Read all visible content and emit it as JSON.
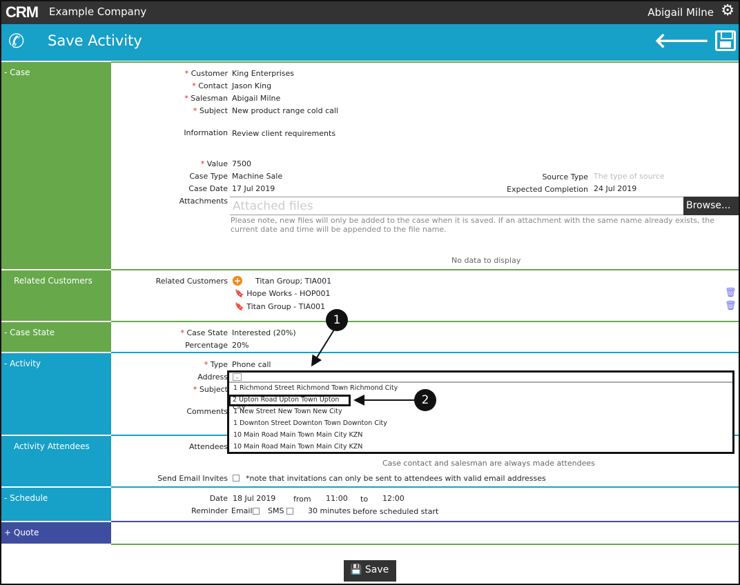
{
  "topbar": {
    "logo": "CRM",
    "company": "Example Company",
    "user": "Abigail Milne"
  },
  "titlebar": {
    "title": "Save Activity"
  },
  "sections": {
    "case": "Case",
    "related": "Related Customers",
    "case_state": "Case State",
    "activity": "Activity",
    "attendees": "Activity Attendees",
    "schedule": "Schedule",
    "quote": "Quote"
  },
  "case": {
    "customer_label": "Customer",
    "customer": "King Enterprises",
    "contact_label": "Contact",
    "contact": "Jason King",
    "salesman_label": "Salesman",
    "salesman": "Abigail Milne",
    "subject_label": "Subject",
    "subject": "New product range cold call",
    "information_label": "Information",
    "information": "Review client requirements",
    "value_label": "Value",
    "value": "7500",
    "case_type_label": "Case Type",
    "case_type": "Machine Sale",
    "case_date_label": "Case Date",
    "case_date": "17 Jul 2019",
    "source_type_label": "Source Type",
    "source_type_placeholder": "The type of source",
    "expected_label": "Expected Completion",
    "expected": "24 Jul 2019",
    "attachments_label": "Attachments",
    "attachments_placeholder": "Attached files",
    "browse": "Browse...",
    "note": "Please note, new files will only be added to the case when it is saved. If an attachment with the same name already exists, the current date and time will be appended to the file name.",
    "no_data": "No data to display"
  },
  "related": {
    "label": "Related Customers",
    "summary": "Titan Group; TIA001",
    "items": [
      "Hope Works - HOP001",
      "Titan Group - TIA001"
    ]
  },
  "case_state": {
    "state_label": "Case State",
    "state": "Interested (20%)",
    "percentage_label": "Percentage",
    "percentage": "20%"
  },
  "activity": {
    "type_label": "Type",
    "type": "Phone call",
    "address_label": "Address",
    "subject_label": "Subject",
    "comments_label": "Comments",
    "address_options": [
      "1 Richmond Street Richmond Town Richmond City",
      "2 Upton Road Upton Town Upton City",
      "1 New Street New Town New City",
      "1 Downton Street Downton Town Downton City",
      "10 Main Road Main Town Main City KZN",
      "10 Main Road Main Town Main City KZN"
    ]
  },
  "attendees": {
    "label": "Attendees",
    "note": "Case contact and salesman are always made attendees",
    "invite_label": "Send Email Invites",
    "invite_note": "*note that invitations can only be sent to attendees with valid email addresses"
  },
  "schedule": {
    "date_label": "Date",
    "date": "18 Jul 2019",
    "from_label": "from",
    "from": "11:00",
    "to_label": "to",
    "to": "12:00",
    "reminder_label": "Reminder",
    "email_label": "Email",
    "sms_label": "SMS",
    "minutes": "30 minutes",
    "before": "before scheduled start"
  },
  "callouts": [
    "1",
    "2"
  ],
  "footer": {
    "save": "Save"
  }
}
